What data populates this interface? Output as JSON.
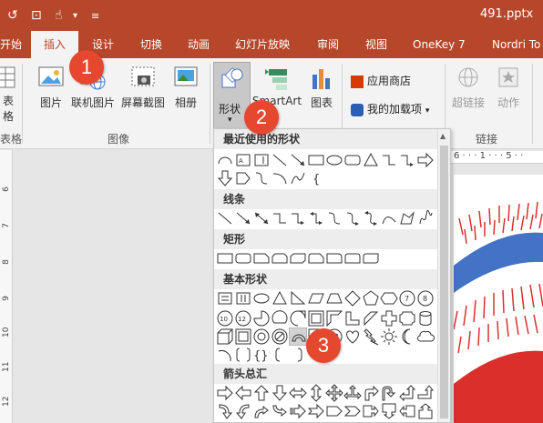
{
  "title_bar": {
    "file_name": "491.pptx"
  },
  "tabs": [
    {
      "label": "开始"
    },
    {
      "label": "插入"
    },
    {
      "label": "设计"
    },
    {
      "label": "切换"
    },
    {
      "label": "动画"
    },
    {
      "label": "幻灯片放映"
    },
    {
      "label": "审阅"
    },
    {
      "label": "视图"
    },
    {
      "label": "OneKey 7"
    },
    {
      "label": "Nordri To"
    }
  ],
  "ribbon": {
    "table_label": "表格",
    "table_group": "表格",
    "images_group": "图像",
    "links_group": "链接",
    "buttons": {
      "picture": "图片",
      "online_picture": "联机图片",
      "screenshot": "屏幕截图",
      "album": "相册",
      "shapes": "形状",
      "smartart": "SmartArt",
      "chart": "图表",
      "store": "应用商店",
      "my_addins": "我的加载项",
      "hyperlink": "超链接",
      "action": "动作"
    }
  },
  "dropdown": {
    "sections": {
      "recent": "最近使用的形状",
      "lines": "线条",
      "rectangles": "矩形",
      "basic": "基本形状",
      "arrows": "箭头总汇"
    }
  },
  "badges": {
    "one": "1",
    "two": "2",
    "three": "3"
  },
  "ruler": {
    "top_label": "6 · · · 1 · · · 5 · ·",
    "left_numbers": [
      "6",
      "7",
      "8",
      "9",
      "10",
      "11",
      "12"
    ]
  },
  "colors": {
    "accent": "#b7472a",
    "badge": "#e5472f",
    "slide_blue": "#4472c4",
    "slide_red": "#d9302c"
  }
}
